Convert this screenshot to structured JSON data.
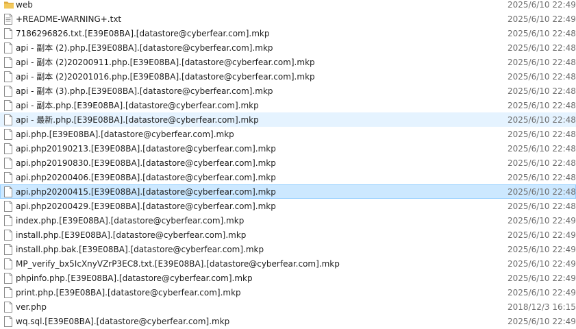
{
  "files": [
    {
      "name": "web",
      "date": "2025/6/10 22:49",
      "icon": "folder-icon"
    },
    {
      "name": "+README-WARNING+.txt",
      "date": "2025/6/10 22:49",
      "icon": "text-file-icon"
    },
    {
      "name": "7186296826.txt.[E39E08BA].[datastore@cyberfear.com].mkp",
      "date": "2025/6/10 22:48",
      "icon": "file-icon"
    },
    {
      "name": "api - 副本 (2).php.[E39E08BA].[datastore@cyberfear.com].mkp",
      "date": "2025/6/10 22:48",
      "icon": "file-icon"
    },
    {
      "name": "api - 副本 (2)20200911.php.[E39E08BA].[datastore@cyberfear.com].mkp",
      "date": "2025/6/10 22:48",
      "icon": "file-icon"
    },
    {
      "name": "api - 副本 (2)20201016.php.[E39E08BA].[datastore@cyberfear.com].mkp",
      "date": "2025/6/10 22:48",
      "icon": "file-icon"
    },
    {
      "name": "api - 副本 (3).php.[E39E08BA].[datastore@cyberfear.com].mkp",
      "date": "2025/6/10 22:48",
      "icon": "file-icon"
    },
    {
      "name": "api - 副本.php.[E39E08BA].[datastore@cyberfear.com].mkp",
      "date": "2025/6/10 22:48",
      "icon": "file-icon"
    },
    {
      "name": "api - 最新.php.[E39E08BA].[datastore@cyberfear.com].mkp",
      "date": "2025/6/10 22:48",
      "icon": "file-icon"
    },
    {
      "name": "api.php.[E39E08BA].[datastore@cyberfear.com].mkp",
      "date": "2025/6/10 22:48",
      "icon": "file-icon"
    },
    {
      "name": "api.php20190213.[E39E08BA].[datastore@cyberfear.com].mkp",
      "date": "2025/6/10 22:48",
      "icon": "file-icon"
    },
    {
      "name": "api.php20190830.[E39E08BA].[datastore@cyberfear.com].mkp",
      "date": "2025/6/10 22:48",
      "icon": "file-icon"
    },
    {
      "name": "api.php20200406.[E39E08BA].[datastore@cyberfear.com].mkp",
      "date": "2025/6/10 22:48",
      "icon": "file-icon"
    },
    {
      "name": "api.php20200415.[E39E08BA].[datastore@cyberfear.com].mkp",
      "date": "2025/6/10 22:48",
      "icon": "file-icon"
    },
    {
      "name": "api.php20200429.[E39E08BA].[datastore@cyberfear.com].mkp",
      "date": "2025/6/10 22:48",
      "icon": "file-icon"
    },
    {
      "name": "index.php.[E39E08BA].[datastore@cyberfear.com].mkp",
      "date": "2025/6/10 22:49",
      "icon": "file-icon"
    },
    {
      "name": "install.php.[E39E08BA].[datastore@cyberfear.com].mkp",
      "date": "2025/6/10 22:49",
      "icon": "file-icon"
    },
    {
      "name": "install.php.bak.[E39E08BA].[datastore@cyberfear.com].mkp",
      "date": "2025/6/10 22:49",
      "icon": "file-icon"
    },
    {
      "name": "MP_verify_bx5IcXnyVZrP3EC8.txt.[E39E08BA].[datastore@cyberfear.com].mkp",
      "date": "2025/6/10 22:49",
      "icon": "file-icon"
    },
    {
      "name": "phpinfo.php.[E39E08BA].[datastore@cyberfear.com].mkp",
      "date": "2025/6/10 22:49",
      "icon": "file-icon"
    },
    {
      "name": "print.php.[E39E08BA].[datastore@cyberfear.com].mkp",
      "date": "2025/6/10 22:49",
      "icon": "file-icon"
    },
    {
      "name": "ver.php",
      "date": "2018/12/3 16:15",
      "icon": "file-icon"
    },
    {
      "name": "wq.sql.[E39E08BA].[datastore@cyberfear.com].mkp",
      "date": "2025/6/10 22:49",
      "icon": "file-icon"
    }
  ],
  "hover_index": 8,
  "selected_index": 13,
  "colors": {
    "hover": "#e5f3ff",
    "selected": "#cce8ff",
    "selected_border": "#99d1ff",
    "folder": "#e8b548",
    "date_text": "#6d6d6d"
  }
}
